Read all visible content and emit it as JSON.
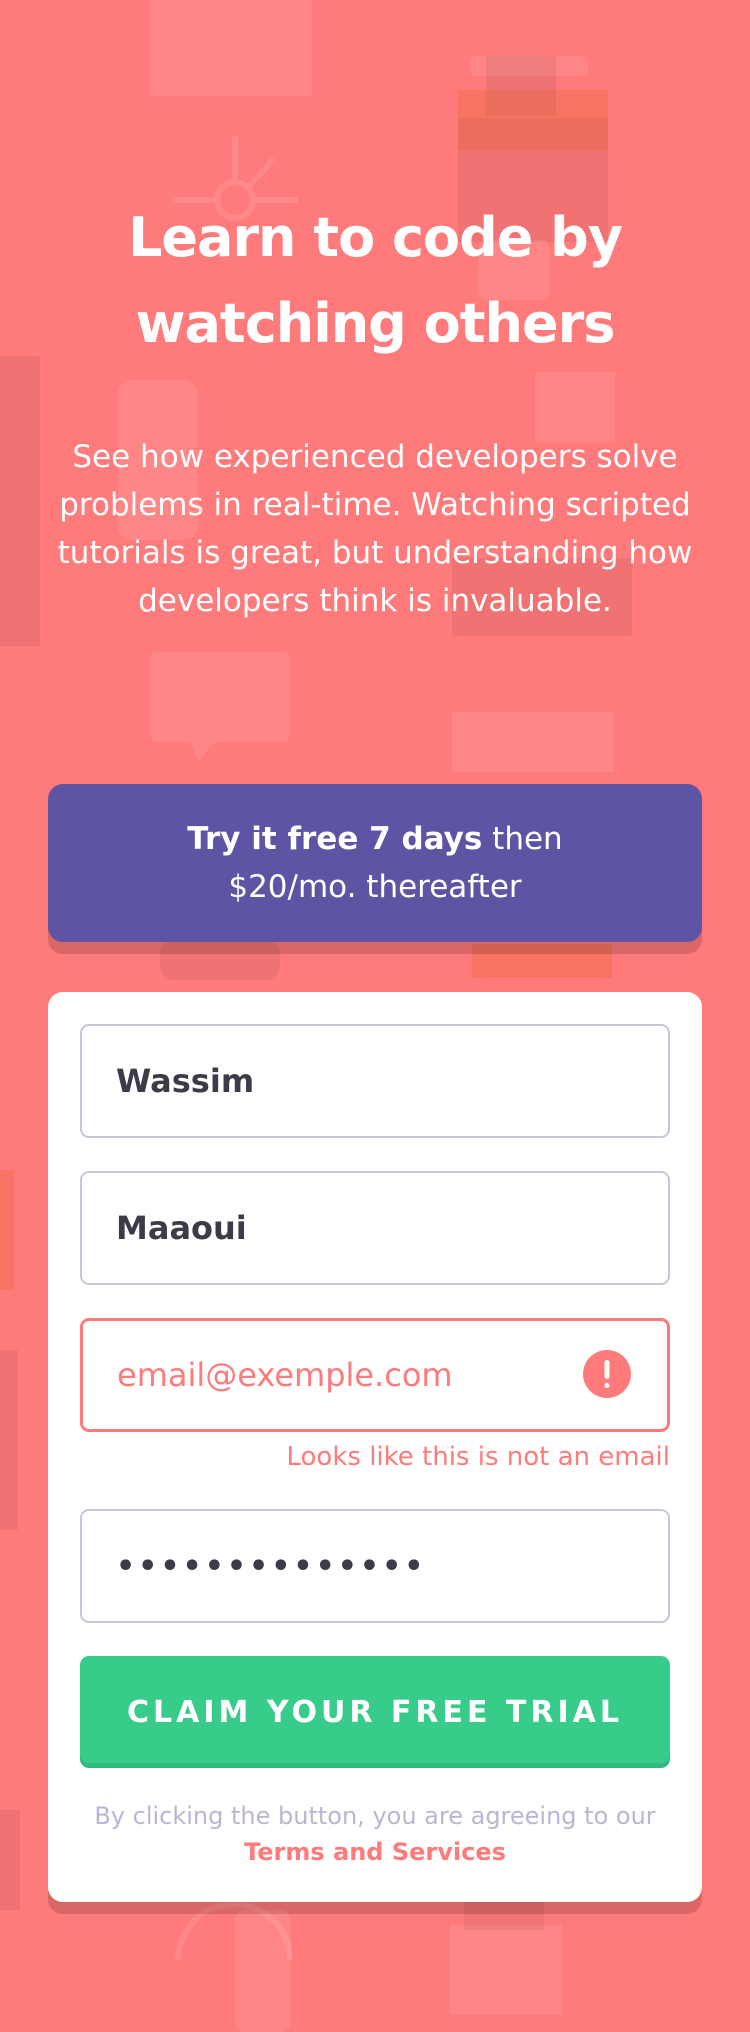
{
  "hero": {
    "title_line1": "Learn to code by",
    "title_line2": "watching others",
    "description": "See how experienced developers solve problems in real-time. Watching scripted tutorials is great, but understanding how developers think is invaluable."
  },
  "promo": {
    "bold": "Try it free 7 days",
    "rest1": " then",
    "rest2": "$20/mo. thereafter"
  },
  "form": {
    "first_name_value": "Wassim",
    "last_name_value": "Maaoui",
    "email_value": "email@exemple.com",
    "email_error": "Looks like this is not an email",
    "password_value": "••••••••••••••",
    "submit_label": "CLAIM YOUR FREE TRIAL",
    "terms_text": "By clicking the button, you are agreeing to our ",
    "terms_link": "Terms and Services"
  },
  "colors": {
    "background": "#ff7a7a",
    "promo": "#5e54a4",
    "submit": "#38cc8b",
    "error": "#ff7a7a"
  },
  "icons": {
    "error": "exclamation-circle-icon"
  }
}
